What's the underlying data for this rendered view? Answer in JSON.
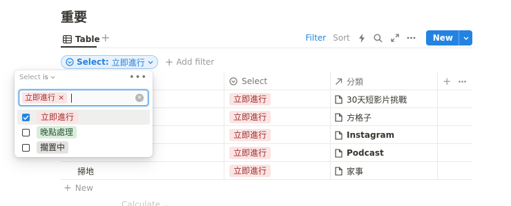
{
  "page": {
    "title": "重要"
  },
  "view": {
    "tab_label": "Table",
    "toolbar": {
      "filter_label": "Filter",
      "sort_label": "Sort",
      "new_label": "New"
    }
  },
  "filter": {
    "chip_prop": "Select:",
    "chip_value": "立即進行",
    "add_label": "Add filter"
  },
  "table": {
    "headers": {
      "select": "Select",
      "category": "分類"
    },
    "rows": [
      {
        "name": "",
        "select": "立即進行",
        "category": "30天短影片挑戰"
      },
      {
        "name": "",
        "select": "立即進行",
        "category": "方格子"
      },
      {
        "name": "",
        "select": "立即進行",
        "category": "Instagram"
      },
      {
        "name": "",
        "select": "立即進行",
        "category": "Podcast"
      },
      {
        "name": "掃地",
        "select": "立即進行",
        "category": "家事"
      }
    ],
    "new_label": "New",
    "calculate_label": "Calculate"
  },
  "popover": {
    "prop_label": "Select",
    "operator": "is",
    "selected_chip": "立即進行",
    "options": [
      {
        "label": "立即進行",
        "checked": true,
        "color": "red"
      },
      {
        "label": "晚點處理",
        "checked": false,
        "color": "green"
      },
      {
        "label": "擱置中",
        "checked": false,
        "color": "gray"
      }
    ]
  },
  "colors": {
    "accent": "#2383e2",
    "tag_red": "#fbe4e4",
    "tag_green": "#dbeddb",
    "tag_gray": "#e3e2e0"
  }
}
